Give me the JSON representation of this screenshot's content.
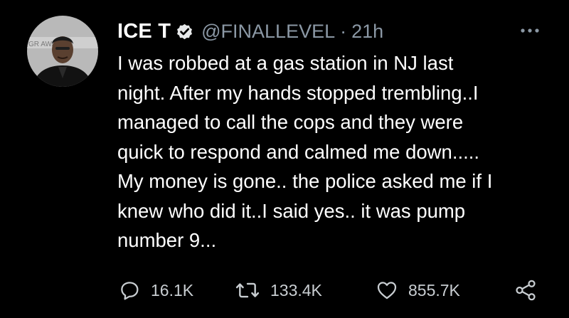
{
  "tweet": {
    "display_name": "ICE T",
    "handle": "@FINALLEVEL",
    "separator": "·",
    "time": "21h",
    "text": "I was robbed at a gas station in NJ last\nnight. After my hands stopped trembling..I\nmanaged to call the cops and they were\nquick to respond and calmed me down.....\nMy money is gone.. the police asked me if I\nknew who did it..I said yes.. it was pump\nnumber 9...",
    "avatar_backdrop_text": "GR        AWAR",
    "icons": {
      "verified": "verified-badge-icon",
      "more": "more-options-icon",
      "reply": "reply-icon",
      "retweet": "retweet-icon",
      "like": "heart-icon",
      "share": "share-icon"
    }
  },
  "actions": {
    "reply_count": "16.1K",
    "retweet_count": "133.4K",
    "like_count": "855.7K"
  },
  "colors": {
    "background": "#000000",
    "text": "#ffffff",
    "secondary": "#8b98a5"
  }
}
